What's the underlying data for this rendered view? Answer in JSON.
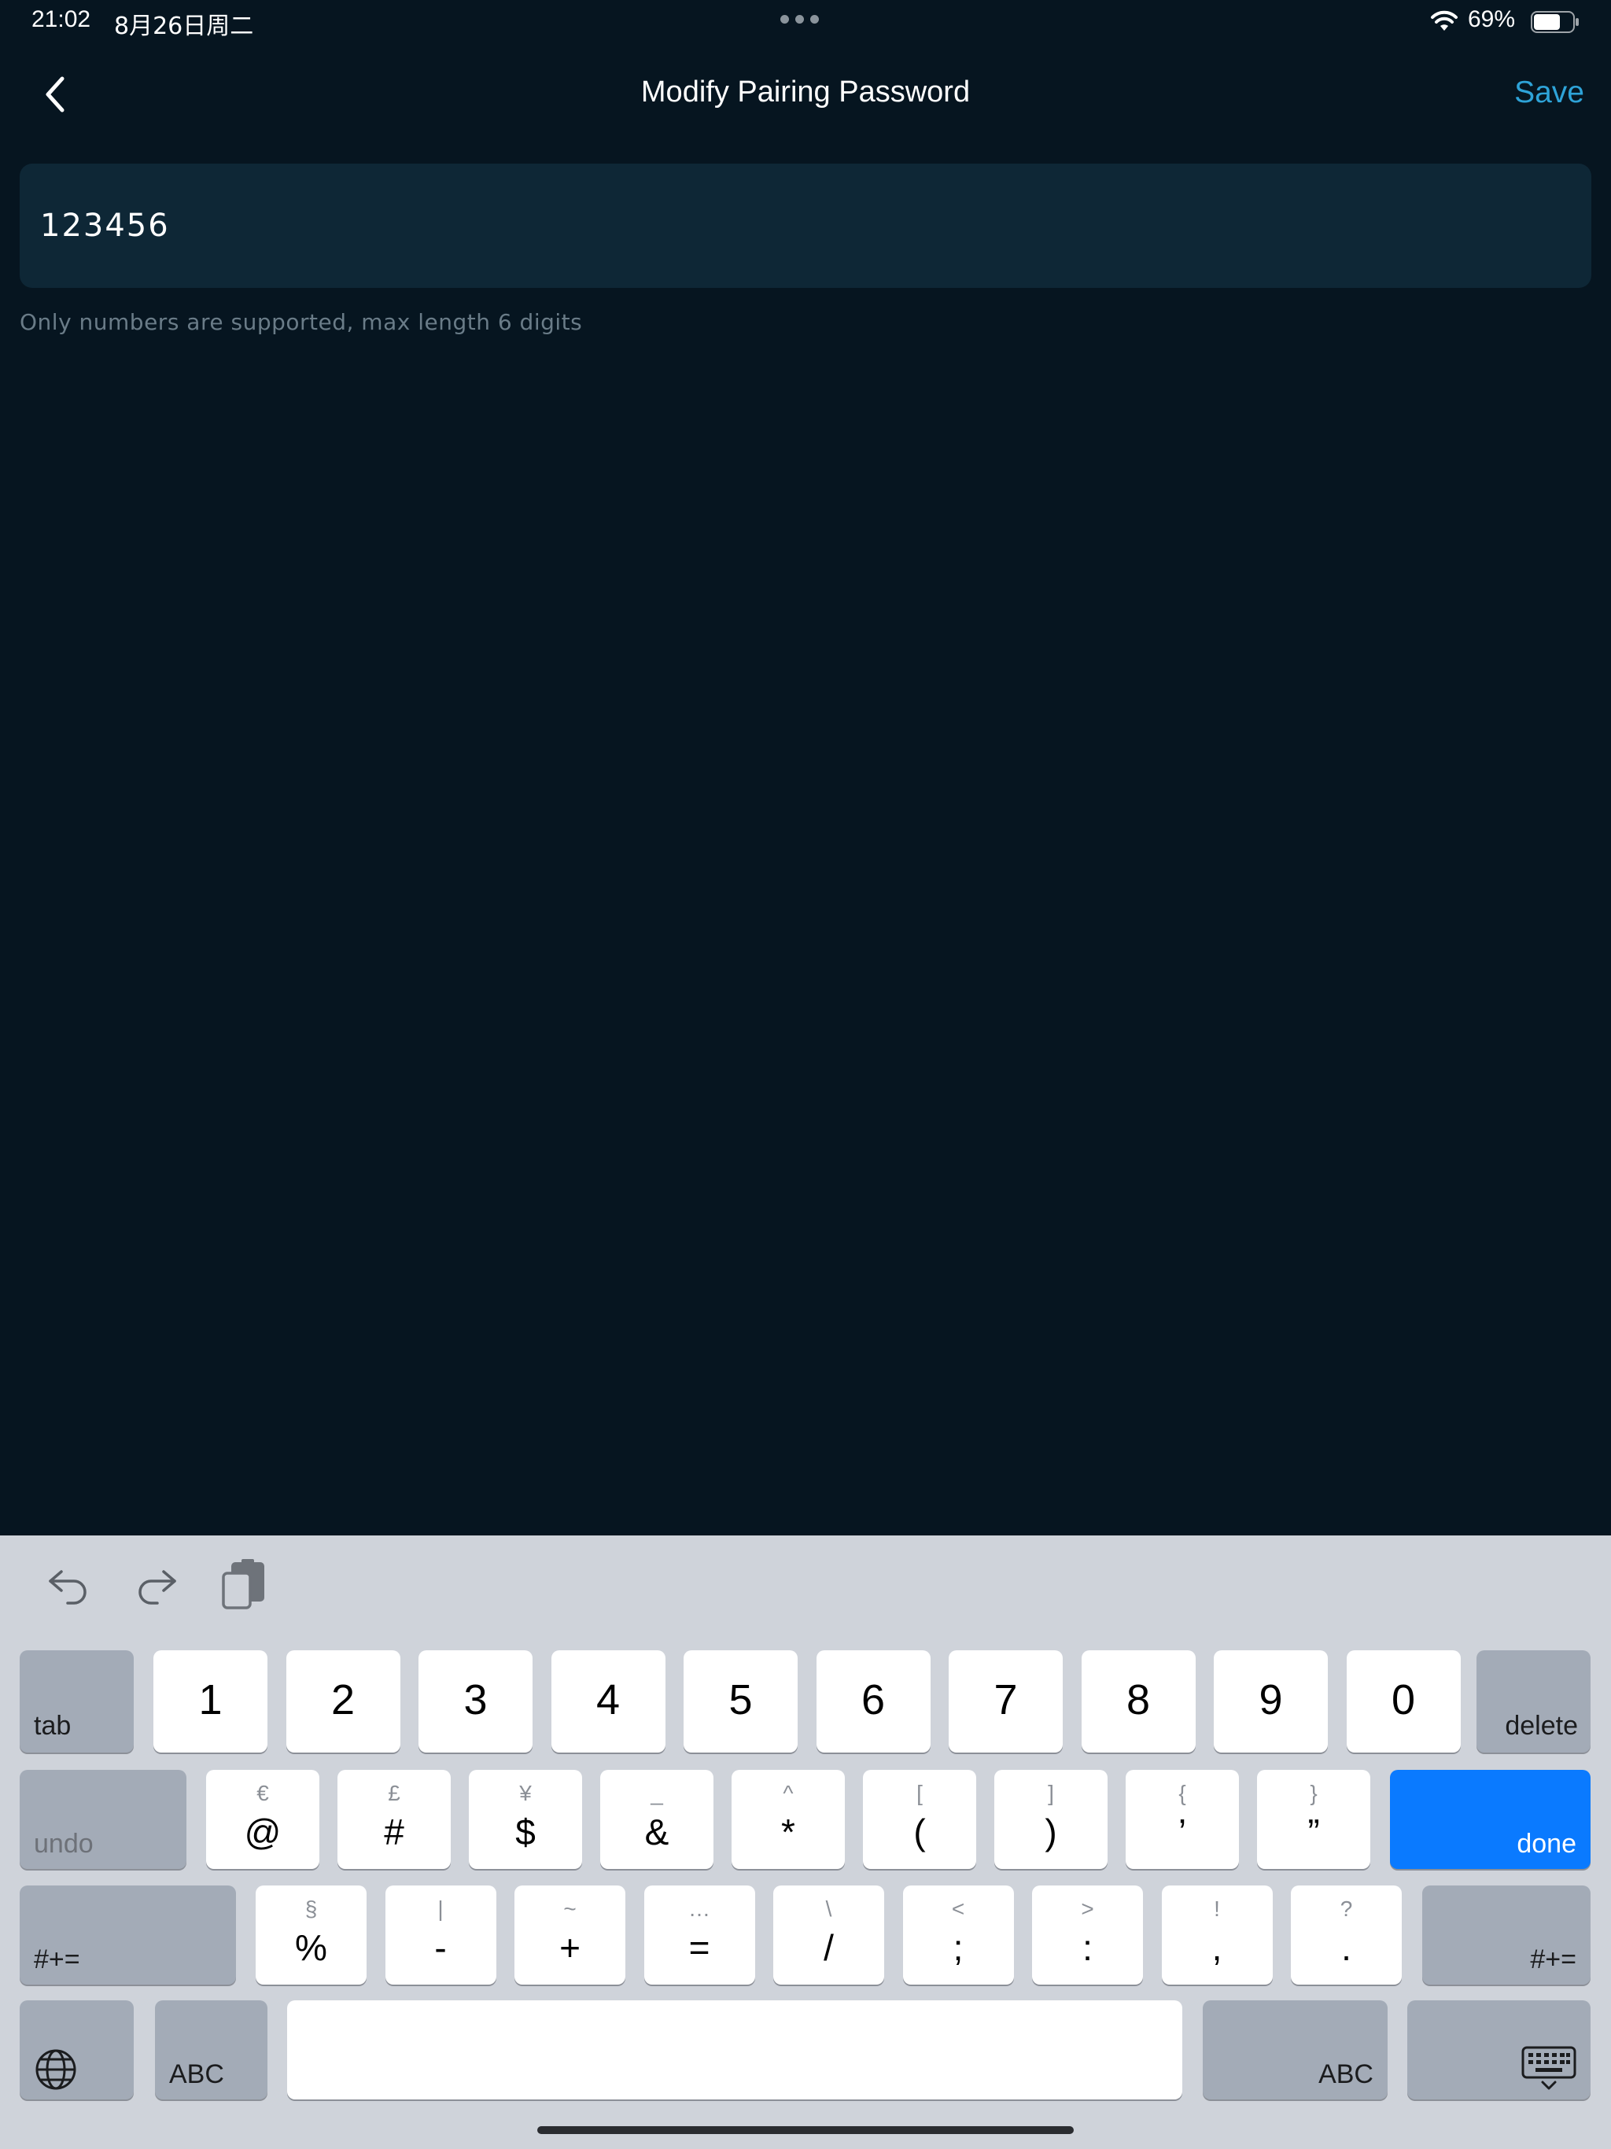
{
  "status_bar": {
    "time": "21:02",
    "date": "8月26日周二",
    "battery_percent": "69%",
    "battery_level": 0.69
  },
  "nav": {
    "title": "Modify Pairing Password",
    "save_label": "Save",
    "back_icon": "chevron-left-icon"
  },
  "form": {
    "password_value": "123456",
    "hint": "Only numbers are supported, max length 6 digits"
  },
  "keyboard": {
    "toolbar": [
      "undo-arrow-icon",
      "redo-arrow-icon",
      "paste-clipboard-icon"
    ],
    "row1": {
      "tab": "tab",
      "keys": [
        "1",
        "2",
        "3",
        "4",
        "5",
        "6",
        "7",
        "8",
        "9",
        "0"
      ],
      "delete": "delete"
    },
    "row2": {
      "undo": "undo",
      "keys": [
        {
          "main": "@",
          "alt": "€"
        },
        {
          "main": "#",
          "alt": "£"
        },
        {
          "main": "$",
          "alt": "¥"
        },
        {
          "main": "&",
          "alt": "_"
        },
        {
          "main": "*",
          "alt": "^"
        },
        {
          "main": "(",
          "alt": "["
        },
        {
          "main": ")",
          "alt": "]"
        },
        {
          "main": "’",
          "alt": "{"
        },
        {
          "main": "”",
          "alt": "}"
        }
      ],
      "done": "done"
    },
    "row3": {
      "shift_left": "#+=",
      "keys": [
        {
          "main": "%",
          "alt": "§"
        },
        {
          "main": "-",
          "alt": "|"
        },
        {
          "main": "+",
          "alt": "~"
        },
        {
          "main": "=",
          "alt": "…"
        },
        {
          "main": "/",
          "alt": "\\"
        },
        {
          "main": ";",
          "alt": "<"
        },
        {
          "main": ":",
          "alt": ">"
        },
        {
          "main": ",",
          "alt": "!"
        },
        {
          "main": ".",
          "alt": "?"
        }
      ],
      "shift_right": "#+="
    },
    "row4": {
      "globe_icon": "globe-icon",
      "abc_left": "ABC",
      "abc_right": "ABC",
      "dismiss_icon": "keyboard-dismiss-icon"
    },
    "colors": {
      "done": "#0a7aff",
      "accent": "#2ea3d8"
    }
  }
}
